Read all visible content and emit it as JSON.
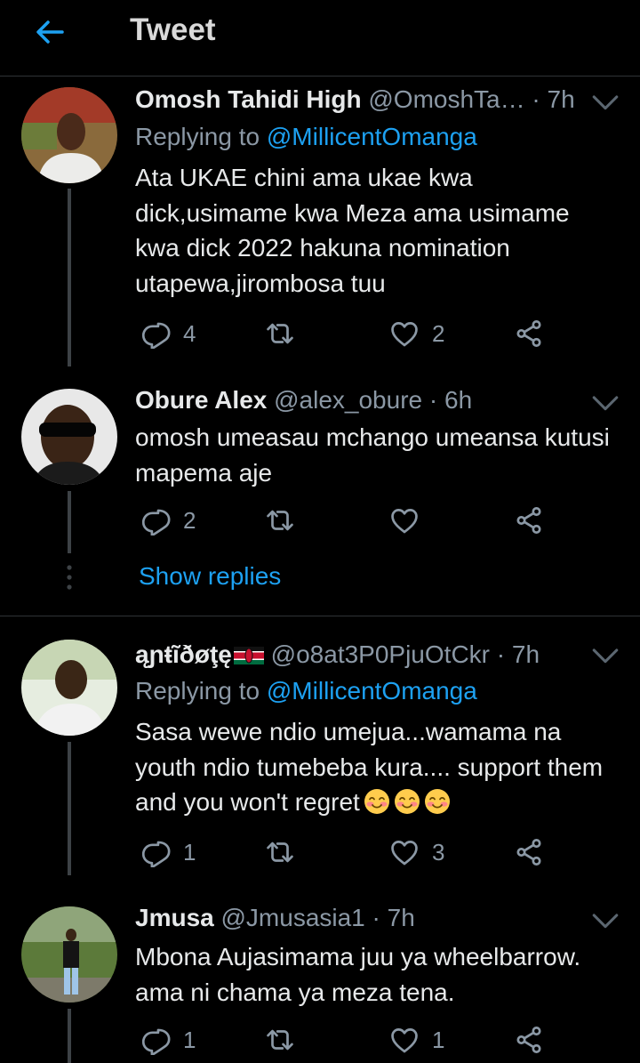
{
  "header": {
    "title": "Tweet"
  },
  "tweets": [
    {
      "name": "Omosh Tahidi High",
      "handle": "@OmoshTa…",
      "time": "· 7h",
      "replying_prefix": "Replying to ",
      "replying_to": "@MillicentOmanga",
      "text": "Ata UKAE chini ama ukae kwa dick,usimame kwa Meza ama usimame kwa dick 2022 hakuna nomination utapewa,jirombosa tuu",
      "replies": "4",
      "retweets": "",
      "likes": "2"
    },
    {
      "name": "Obure Alex",
      "handle": "@alex_obure",
      "time": "· 6h",
      "text": "omosh umeasau mchango umeansa kutusi mapema aje",
      "replies": "2",
      "retweets": "",
      "likes": ""
    },
    {
      "name": "ąɲŧĩðøţę",
      "handle": "@o8at3P0PjuOtCkr",
      "time": "· 7h",
      "replying_prefix": "Replying to ",
      "replying_to": "@MillicentOmanga",
      "text": "Sasa wewe ndio umejua...wamama na youth ndio tumebeba kura.... support them and you won't regret",
      "replies": "1",
      "retweets": "",
      "likes": "3"
    },
    {
      "name": "Jmusa",
      "handle": "@Jmusasia1",
      "time": "· 7h",
      "text": "Mbona Aujasimama juu ya wheelbarrow. ama ni chama ya meza tena.",
      "replies": "1",
      "retweets": "",
      "likes": "1"
    }
  ],
  "show_replies": "Show replies",
  "colors": {
    "accent": "#1da1f2",
    "background": "#000000",
    "muted": "#8b98a5",
    "text": "#e7e9ea"
  },
  "icons": [
    "back-arrow-icon",
    "chevron-down-icon",
    "reply-icon",
    "retweet-icon",
    "like-icon",
    "share-icon",
    "kenya-flag-icon",
    "smiling-face-emoji"
  ]
}
